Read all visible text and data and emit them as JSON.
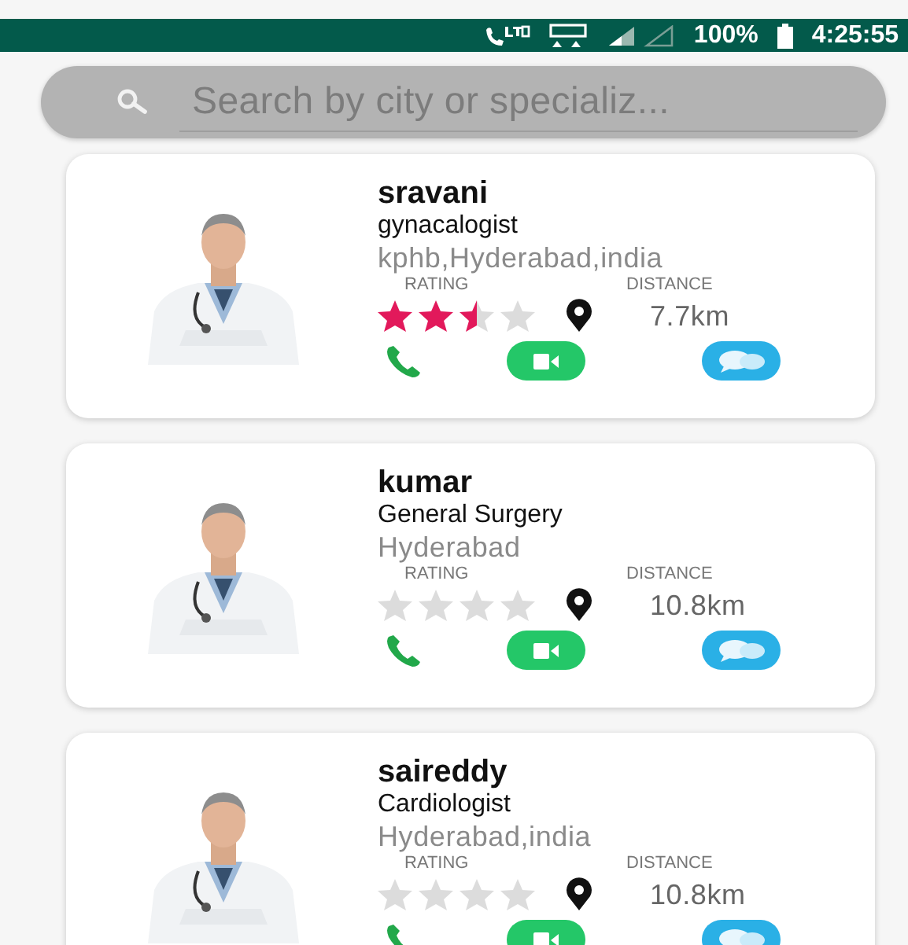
{
  "status_bar": {
    "battery": "100%",
    "time": "4:25:55"
  },
  "search": {
    "placeholder": "Search by city or specializ..."
  },
  "doctors": [
    {
      "name": "sravani",
      "specialty": "gynacalogist",
      "location": "kphb,Hyderabad,india",
      "rating_label": "RATING",
      "stars": 2.5,
      "distance_label": "DISTANCE",
      "distance": "7.7km"
    },
    {
      "name": "kumar",
      "specialty": "General Surgery",
      "location": "Hyderabad",
      "rating_label": "RATING",
      "stars": 0,
      "distance_label": "DISTANCE",
      "distance": "10.8km"
    },
    {
      "name": "saireddy",
      "specialty": "Cardiologist",
      "location": "Hyderabad,india",
      "rating_label": "RATING",
      "stars": 0,
      "distance_label": "DISTANCE",
      "distance": "10.8km"
    }
  ]
}
